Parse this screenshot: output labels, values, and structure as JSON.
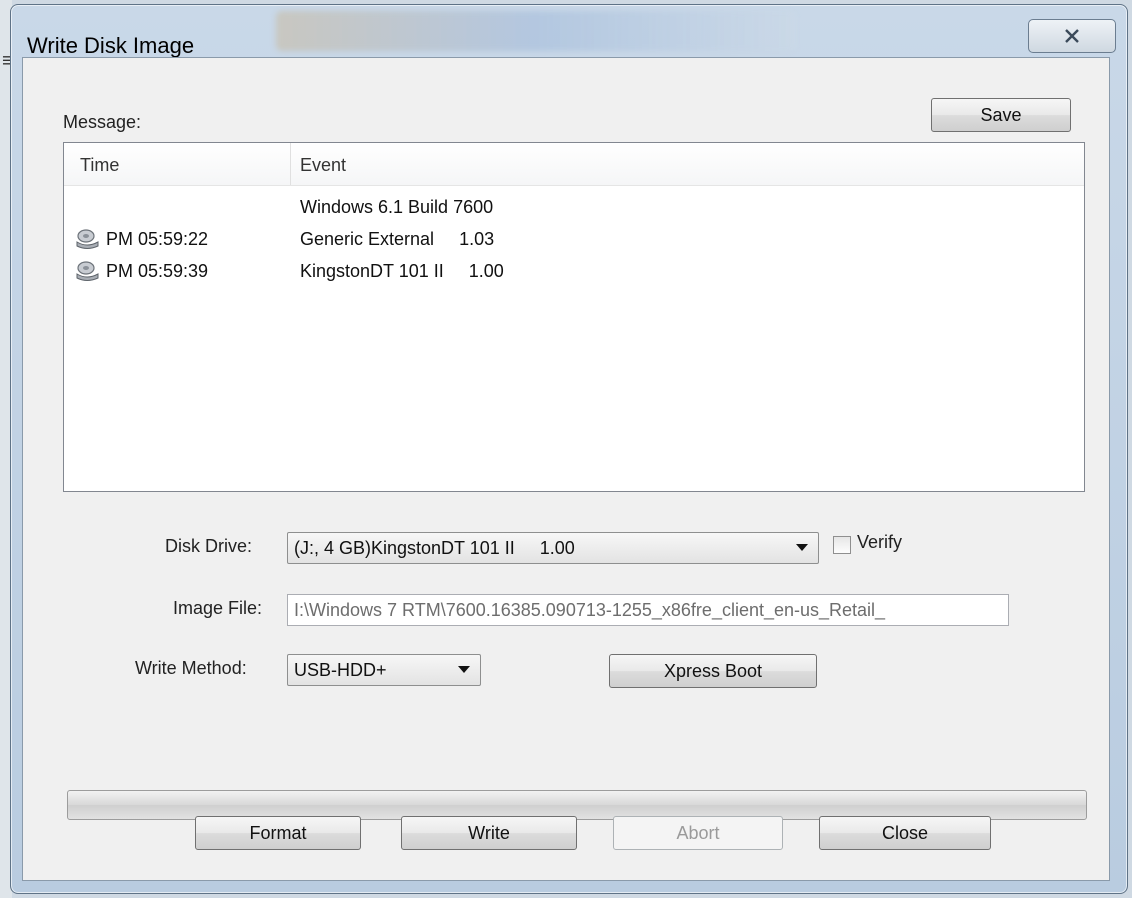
{
  "window": {
    "title": "Write Disk Image"
  },
  "message_panel": {
    "label": "Message:",
    "save_label": "Save",
    "columns": [
      "Time",
      "Event"
    ],
    "rows": [
      {
        "time": "",
        "event": "Windows 6.1 Build 7600",
        "icon": ""
      },
      {
        "time": "PM 05:59:22",
        "event": "Generic External     1.03",
        "icon": "drive-icon"
      },
      {
        "time": "PM 05:59:39",
        "event": "KingstonDT 101 II     1.00",
        "icon": "drive-icon"
      }
    ]
  },
  "form": {
    "disk_drive_label": "Disk Drive:",
    "disk_drive_value": "(J:, 4 GB)KingstonDT 101 II     1.00",
    "verify_label": "Verify",
    "verify_checked": false,
    "image_file_label": "Image File:",
    "image_file_value": "I:\\Windows 7 RTM\\7600.16385.090713-1255_x86fre_client_en-us_Retail_",
    "write_method_label": "Write Method:",
    "write_method_value": "USB-HDD+",
    "xpress_boot_label": "Xpress Boot"
  },
  "progress": {
    "value": 0
  },
  "buttons": {
    "format": "Format",
    "write": "Write",
    "abort": "Abort",
    "close": "Close"
  },
  "colors": {
    "progress_fill": "#37b13a",
    "accent": "#5f7387"
  }
}
